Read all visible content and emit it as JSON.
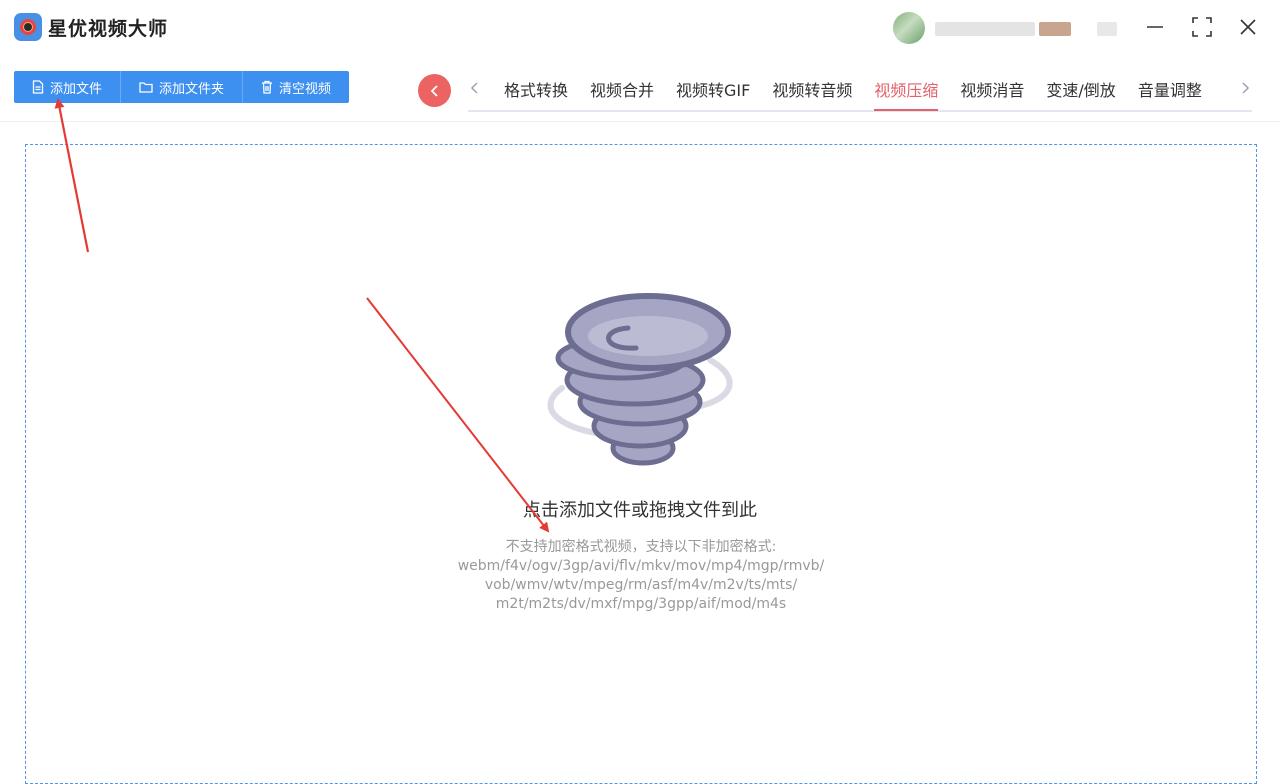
{
  "app": {
    "title": "星优视频大师"
  },
  "toolbar": {
    "add_file": "添加文件",
    "add_folder": "添加文件夹",
    "clear_videos": "清空视频"
  },
  "tabs": [
    {
      "label": "格式转换"
    },
    {
      "label": "视频合并"
    },
    {
      "label": "视频转GIF"
    },
    {
      "label": "视频转音频"
    },
    {
      "label": "视频压缩",
      "active": true
    },
    {
      "label": "视频消音"
    },
    {
      "label": "变速/倒放"
    },
    {
      "label": "音量调整"
    }
  ],
  "dropzone": {
    "title": "点击添加文件或拖拽文件到此",
    "notice": "不支持加密格式视频，支持以下非加密格式:",
    "formats_line1": "webm/f4v/ogv/3gp/avi/flv/mkv/mov/mp4/mgp/rmvb/",
    "formats_line2": "vob/wmv/wtv/mpeg/rm/asf/m4v/m2v/ts/mts/",
    "formats_line3": "m2t/m2ts/dv/mxf/mpg/3gpp/aif/mod/m4s"
  },
  "colors": {
    "accent_blue": "#3d8ff0",
    "active_tab": "#e2626a",
    "nav_back": "#ec6363",
    "annotation_arrow": "#e53935"
  },
  "icons": {
    "logo": "camera-lens-icon",
    "add_file": "file-icon",
    "add_folder": "folder-icon",
    "clear": "trash-icon",
    "minimize": "minimize-icon",
    "maximize": "maximize-icon",
    "close": "close-icon",
    "dropzone": "tornado-icon"
  }
}
